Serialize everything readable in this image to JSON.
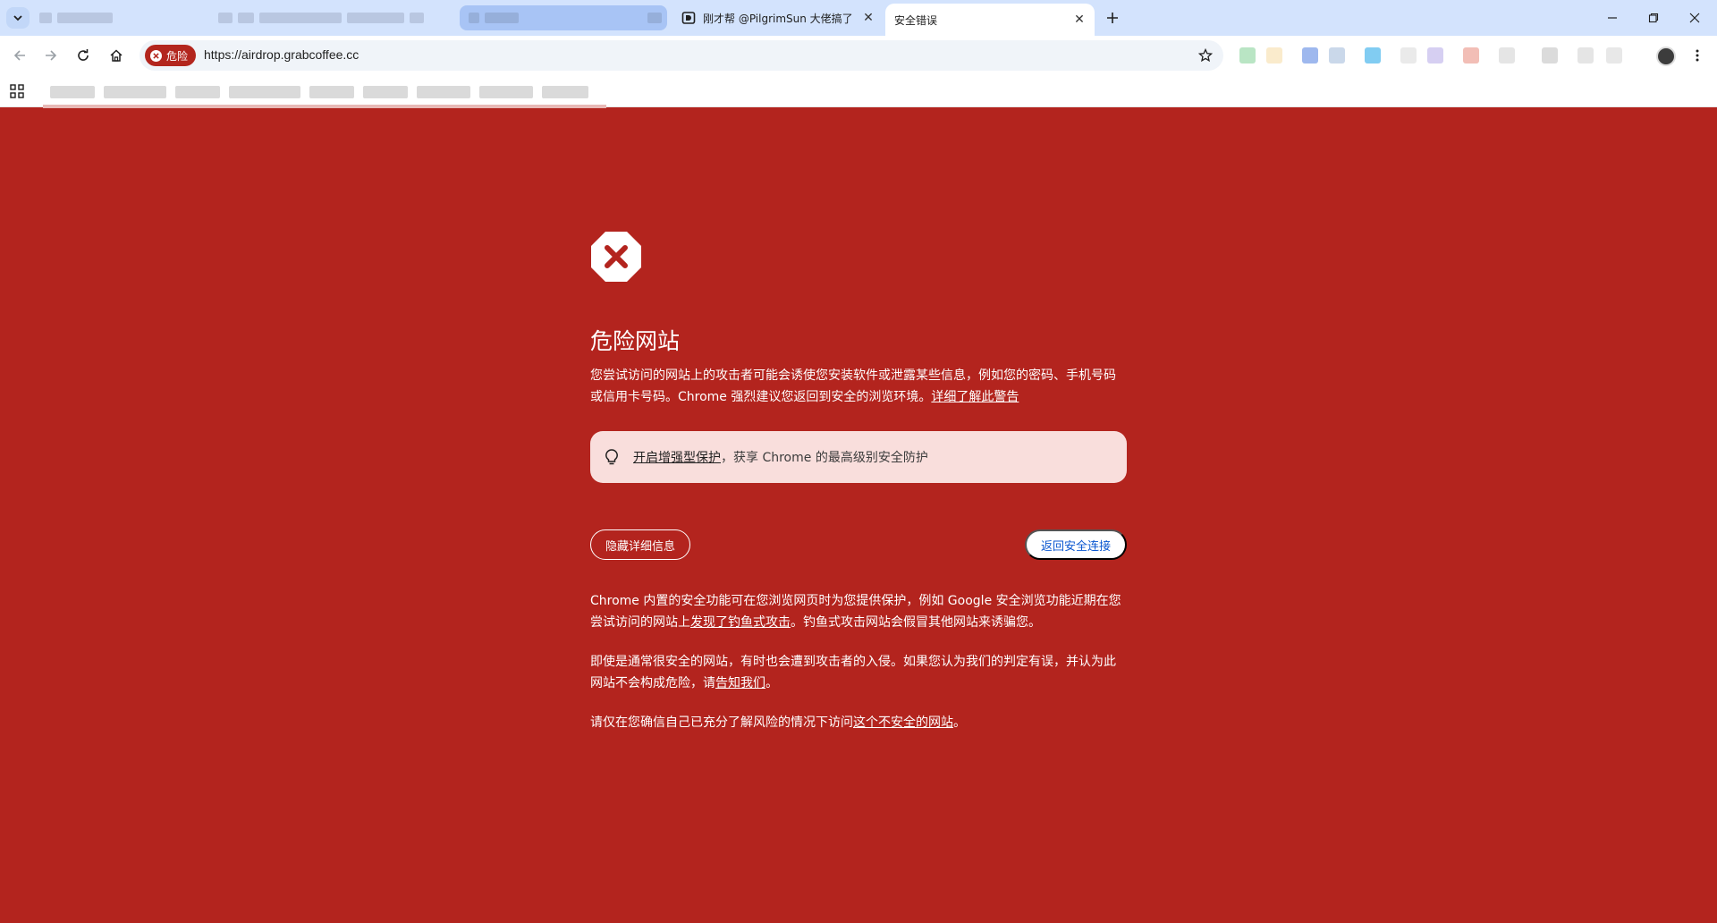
{
  "tabs": [
    {
      "title": "",
      "kind": "blurred"
    },
    {
      "title": "",
      "kind": "blurred"
    },
    {
      "title": "",
      "kind": "blurred-highlight"
    },
    {
      "title": "刚才帮 @PilgrimSun 大佬搞了",
      "kind": "normal"
    },
    {
      "title": "安全错误",
      "kind": "active"
    }
  ],
  "toolbar": {
    "danger_label": "危险",
    "url": "https://airdrop.grabcoffee.cc"
  },
  "page": {
    "heading": "危险网站",
    "intro_text": "您尝试访问的网站上的攻击者可能会诱使您安装软件或泄露某些信息，例如您的密码、手机号码或信用卡号码。Chrome 强烈建议您返回到安全的浏览环境。",
    "intro_link": "详细了解此警告",
    "promo_link": "开启增强型保护",
    "promo_text": "，获享 Chrome 的最高级别安全防护",
    "details_button": "隐藏详细信息",
    "back_button": "返回安全连接",
    "details_p1_a": "Chrome 内置的安全功能可在您浏览网页时为您提供保护，例如 Google 安全浏览功能近期在您尝试访问的网站上",
    "details_p1_link": "发现了钓鱼式攻击",
    "details_p1_b": "。钓鱼式攻击网站会假冒其他网站来诱骗您。",
    "details_p2_a": "即使是通常很安全的网站，有时也会遭到攻击者的入侵。如果您认为我们的判定有误，并认为此网站不会构成危险，请",
    "details_p2_link": "告知我们",
    "details_p2_b": "。",
    "details_p3_a": "请仅在您确信自己已充分了解风险的情况下访问",
    "details_p3_link": "这个不安全的网站",
    "details_p3_b": "。"
  },
  "colors": {
    "danger_bg": "#b3241e",
    "promo_bg": "#f9dedc",
    "tabstrip": "#d3e3fd",
    "link_blue": "#0b57d0"
  }
}
